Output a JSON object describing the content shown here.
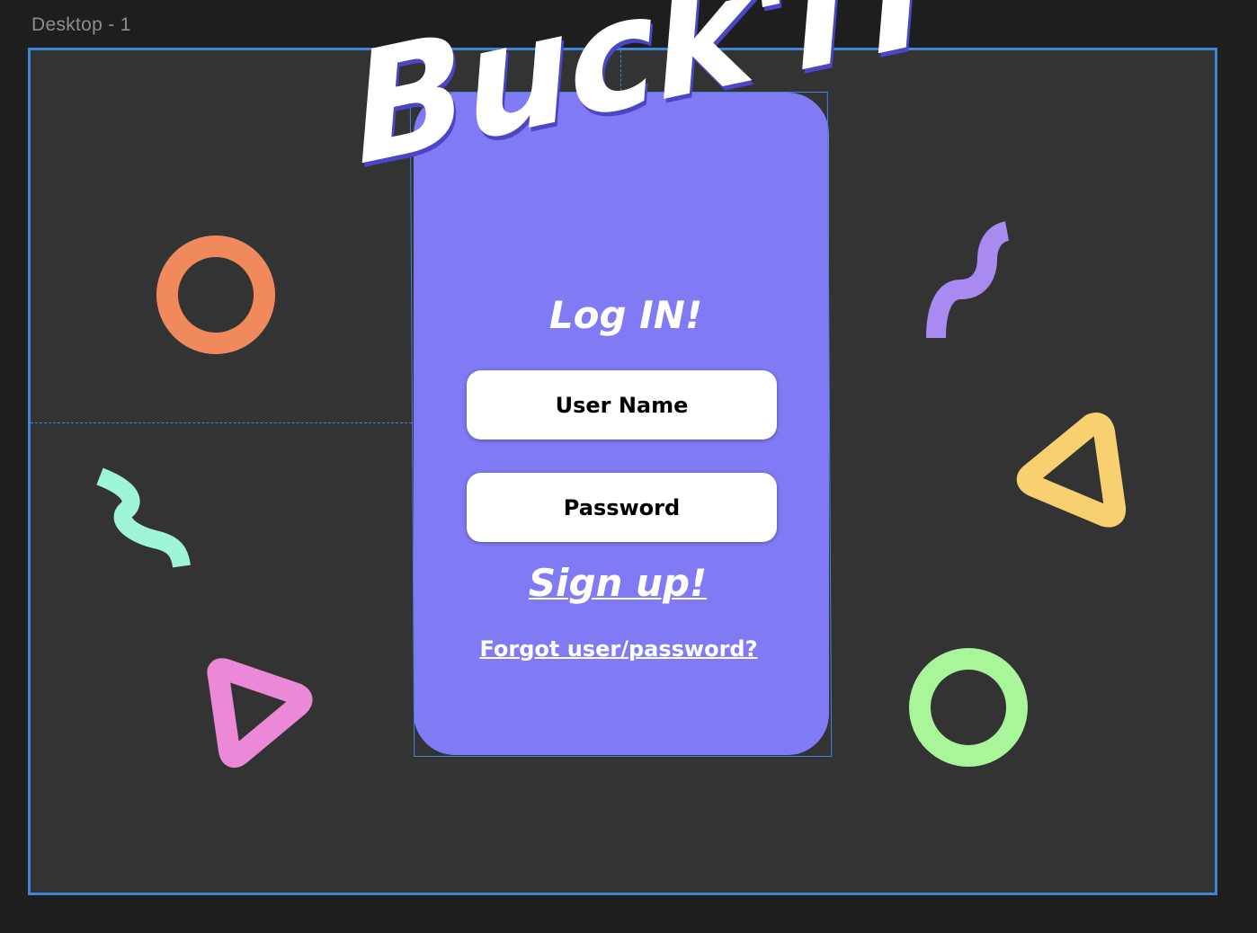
{
  "frame": {
    "title": "Desktop - 1"
  },
  "logo": {
    "text": "Buck'IT"
  },
  "login": {
    "title": "Log IN!",
    "username_label": "User Name",
    "password_label": "Password",
    "signup_label": "Sign up!",
    "forgot_label": "Forgot user/password?"
  },
  "decorations": {
    "orange_circle": {
      "icon": "ring-icon",
      "color": "#f08a5d"
    },
    "purple_squiggle": {
      "icon": "squiggle-icon",
      "color": "#a98af0"
    },
    "mint_squiggle": {
      "icon": "squiggle-icon",
      "color": "#9ef5da"
    },
    "yellow_triangle": {
      "icon": "triangle-icon",
      "color": "#f8d070"
    },
    "pink_triangle": {
      "icon": "triangle-icon",
      "color": "#ec88d8"
    },
    "green_circle": {
      "icon": "ring-icon",
      "color": "#a9f59a"
    }
  },
  "colors": {
    "canvas": "#1e1e1e",
    "frame_bg": "#333333",
    "selection": "#3d86d6",
    "card": "#807bf5"
  }
}
